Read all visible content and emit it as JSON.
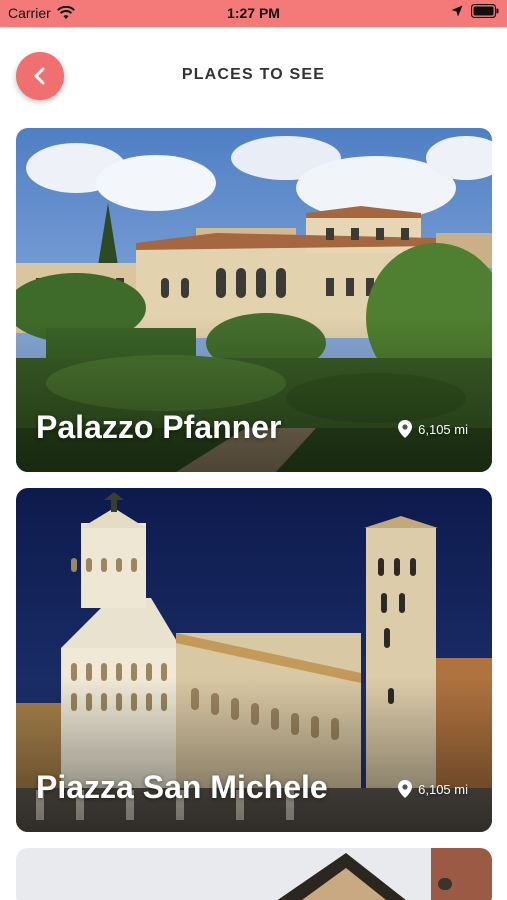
{
  "status_bar": {
    "carrier": "Carrier",
    "time": "1:27 PM"
  },
  "header": {
    "title": "PLACES TO SEE",
    "back_icon": "chevron-left-icon"
  },
  "places": [
    {
      "name": "Palazzo Pfanner",
      "distance": "6,105 mi"
    },
    {
      "name": "Piazza San Michele",
      "distance": "6,105 mi"
    }
  ],
  "colors": {
    "accent": "#f47a7a",
    "back_button": "#f07070"
  }
}
